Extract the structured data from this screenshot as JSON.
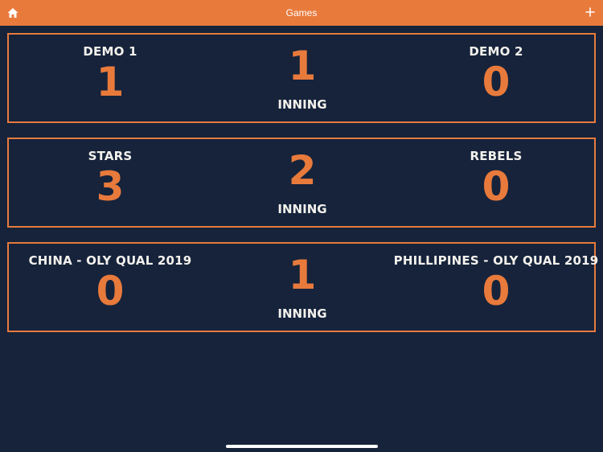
{
  "header": {
    "title": "Games",
    "home_icon": "home-icon",
    "add_icon": "plus-icon"
  },
  "colors": {
    "accent": "#e87a3c",
    "background": "#16233b",
    "text": "#f3f1ec"
  },
  "games": [
    {
      "home_team": "DEMO 1",
      "home_score": "1",
      "inning": "1",
      "inning_label": "INNING",
      "away_team": "DEMO 2",
      "away_score": "0"
    },
    {
      "home_team": "STARS",
      "home_score": "3",
      "inning": "2",
      "inning_label": "INNING",
      "away_team": "REBELS",
      "away_score": "0"
    },
    {
      "home_team": "CHINA - OLY QUAL 2019",
      "home_score": "0",
      "inning": "1",
      "inning_label": "INNING",
      "away_team": "PHILLIPINES - OLY QUAL 2019",
      "away_score": "0"
    }
  ]
}
